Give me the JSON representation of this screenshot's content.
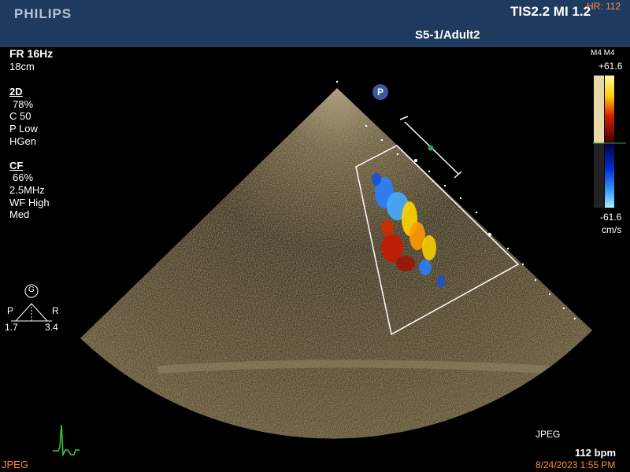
{
  "header": {
    "brand": "PHILIPS",
    "tis_mi": "TIS2.2   MI 1.2",
    "hr": "HR: 112",
    "probe": "S5-1/Adult2"
  },
  "left_panel": {
    "fr": "FR 16Hz",
    "depth": "18cm",
    "mode_2d": "2D",
    "gain_2d": "78%",
    "contrast": "C 50",
    "persistence": "P Low",
    "hgen": "HGen",
    "mode_cf": "CF",
    "gain_cf": "66%",
    "freq": "2.5MHz",
    "wall_filter": "WF High",
    "priority": "Med"
  },
  "orientation": {
    "g_label": "G",
    "p_label": "P",
    "r_label": "R",
    "p_value": "1.7",
    "r_value": "3.4"
  },
  "color_scale": {
    "header": "M4 M4",
    "max": "+61.6",
    "min": "-61.6",
    "unit": "cm/s"
  },
  "marker": {
    "label": "P"
  },
  "footer": {
    "jpeg_left": "JPEG",
    "jpeg_right": "JPEG",
    "bpm": "112 bpm",
    "date": "8/24/2023 1:55 PM"
  },
  "colors": {
    "header_bg": "#1e3a5f",
    "orange_text": "#ff8c3a",
    "ecg_green": "#3ccf3c"
  }
}
